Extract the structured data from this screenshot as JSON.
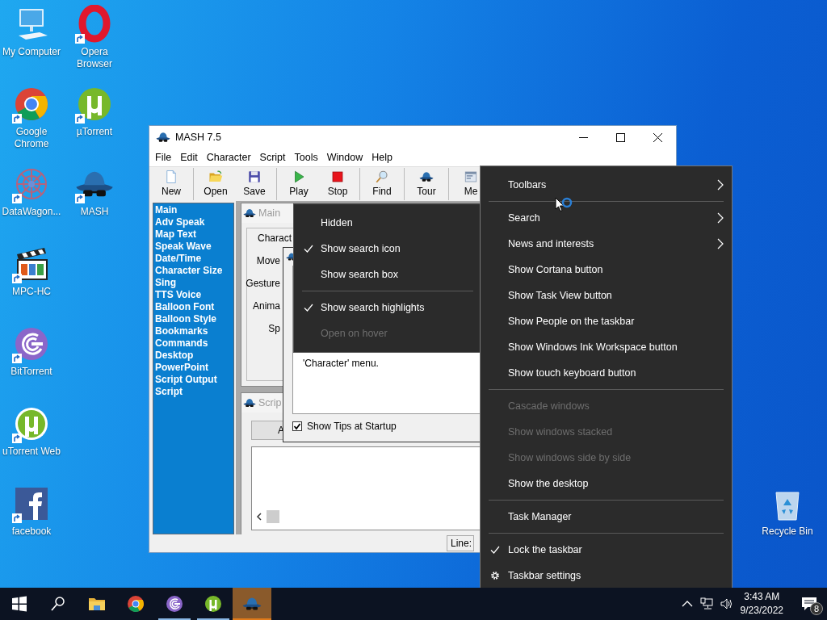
{
  "desktop_icons": {
    "columns": [
      [
        {
          "label": "My Computer",
          "shortcut": false
        },
        {
          "label": "Google Chrome",
          "shortcut": true
        },
        {
          "label": "DataWagon...",
          "shortcut": true
        },
        {
          "label": "MPC-HC",
          "shortcut": true
        },
        {
          "label": "BitTorrent",
          "shortcut": true
        },
        {
          "label": "uTorrent Web",
          "shortcut": true
        },
        {
          "label": "facebook",
          "shortcut": true
        }
      ],
      [
        {
          "label": "Opera Browser",
          "shortcut": true
        },
        {
          "label": "µTorrent",
          "shortcut": true
        },
        {
          "label": "MASH",
          "shortcut": true
        }
      ]
    ]
  },
  "recycle_bin": {
    "label": "Recycle Bin"
  },
  "window": {
    "title": "MASH 7.5",
    "menu": [
      "File",
      "Edit",
      "Character",
      "Script",
      "Tools",
      "Window",
      "Help"
    ],
    "toolbar": [
      [
        {
          "label": "New"
        }
      ],
      [
        {
          "label": "Open"
        },
        {
          "label": "Save"
        }
      ],
      [
        {
          "label": "Play"
        },
        {
          "label": "Stop"
        }
      ],
      [
        {
          "label": "Find"
        }
      ],
      [
        {
          "label": "Tour"
        }
      ],
      [
        {
          "label": "Me"
        }
      ]
    ],
    "sidebar": {
      "items": [
        "Main",
        "Adv Speak",
        "Map Text",
        "Speak Wave",
        "Date/Time",
        "Character Size",
        "Sing",
        "TTS Voice",
        "Balloon Font",
        "Balloon Style",
        "Bookmarks",
        "Commands",
        "Desktop",
        "PowerPoint",
        "Script Output",
        "Script"
      ]
    },
    "main_child": {
      "title": "Main",
      "labels": [
        "Charact",
        "Move",
        "Gesture",
        "Anima",
        "Sp"
      ]
    },
    "tip_dialog": {
      "text": "'Character' menu.",
      "show_tips": {
        "label": "Show Tips at Startup",
        "checked": true
      }
    },
    "script_child": {
      "title": "Scrip",
      "button": "A"
    },
    "status_bar": {
      "line_label": "Line:"
    }
  },
  "search_submenu": {
    "groups": [
      [
        {
          "label": "Hidden",
          "checked": false,
          "disabled": false
        },
        {
          "label": "Show search icon",
          "checked": true,
          "disabled": false
        },
        {
          "label": "Show search box",
          "checked": false,
          "disabled": false
        }
      ],
      [
        {
          "label": "Show search highlights",
          "checked": true,
          "disabled": false
        },
        {
          "label": "Open on hover",
          "checked": false,
          "disabled": true
        }
      ]
    ]
  },
  "context_menu": {
    "groups": [
      [
        {
          "label": "Toolbars",
          "kind": "plain",
          "submenu": true,
          "checked": false,
          "disabled": false
        }
      ],
      [
        {
          "label": "Search",
          "kind": "plain",
          "submenu": true,
          "checked": false,
          "disabled": false
        },
        {
          "label": "News and interests",
          "kind": "plain",
          "submenu": true,
          "checked": false,
          "disabled": false
        },
        {
          "label": "Show Cortana button",
          "kind": "plain",
          "submenu": false,
          "checked": false,
          "disabled": false
        },
        {
          "label": "Show Task View button",
          "kind": "plain",
          "submenu": false,
          "checked": false,
          "disabled": false
        },
        {
          "label": "Show People on the taskbar",
          "kind": "plain",
          "submenu": false,
          "checked": false,
          "disabled": false
        },
        {
          "label": "Show Windows Ink Workspace button",
          "kind": "plain",
          "submenu": false,
          "checked": false,
          "disabled": false
        },
        {
          "label": "Show touch keyboard button",
          "kind": "plain",
          "submenu": false,
          "checked": false,
          "disabled": false
        }
      ],
      [
        {
          "label": "Cascade windows",
          "kind": "plain",
          "submenu": false,
          "checked": false,
          "disabled": true
        },
        {
          "label": "Show windows stacked",
          "kind": "plain",
          "submenu": false,
          "checked": false,
          "disabled": true
        },
        {
          "label": "Show windows side by side",
          "kind": "plain",
          "submenu": false,
          "checked": false,
          "disabled": true
        },
        {
          "label": "Show the desktop",
          "kind": "plain",
          "submenu": false,
          "checked": false,
          "disabled": false
        }
      ],
      [
        {
          "label": "Task Manager",
          "kind": "plain",
          "submenu": false,
          "checked": false,
          "disabled": false
        }
      ],
      [
        {
          "label": "Lock the taskbar",
          "kind": "plain",
          "submenu": false,
          "checked": true,
          "disabled": false
        },
        {
          "label": "Taskbar settings",
          "kind": "settings",
          "submenu": false,
          "checked": false,
          "disabled": false
        }
      ]
    ]
  },
  "taskbar": {
    "buttons": [
      {
        "running": false,
        "selected": false
      },
      {
        "running": false,
        "selected": false
      },
      {
        "running": false,
        "selected": false
      },
      {
        "running": false,
        "selected": false
      },
      {
        "running": true,
        "selected": false
      },
      {
        "running": true,
        "selected": false
      },
      {
        "running": true,
        "selected": true
      }
    ],
    "time": "3:43 AM",
    "date": "9/23/2022",
    "notification_count": "8"
  }
}
